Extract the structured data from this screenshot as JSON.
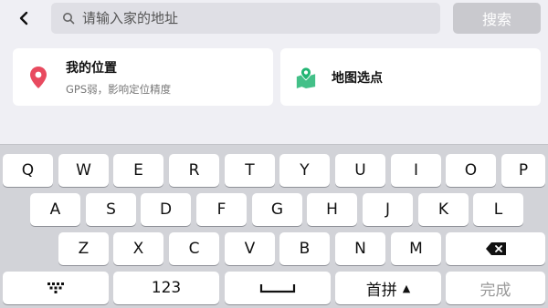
{
  "topbar": {
    "back_icon": "chevron-left-icon",
    "search": {
      "placeholder": "请输入家的地址",
      "value": ""
    },
    "search_button": "搜索"
  },
  "cards": {
    "my_location": {
      "icon": "location-pin-icon",
      "title": "我的位置",
      "subtitle": "GPS弱，影响定位精度",
      "accent": "#e84a5f"
    },
    "map_pick": {
      "icon": "map-pin-icon",
      "title": "地图选点",
      "accent": "#22b573"
    }
  },
  "keyboard": {
    "row1": [
      "Q",
      "W",
      "E",
      "R",
      "T",
      "Y",
      "U",
      "I",
      "O",
      "P"
    ],
    "row2": [
      "A",
      "S",
      "D",
      "F",
      "G",
      "H",
      "J",
      "K",
      "L"
    ],
    "row3": [
      "Z",
      "X",
      "C",
      "V",
      "B",
      "N",
      "M"
    ],
    "bottom": {
      "numbers": "123",
      "ime_label": "首拼",
      "ime_arrow": "▲",
      "done": "完成"
    }
  }
}
